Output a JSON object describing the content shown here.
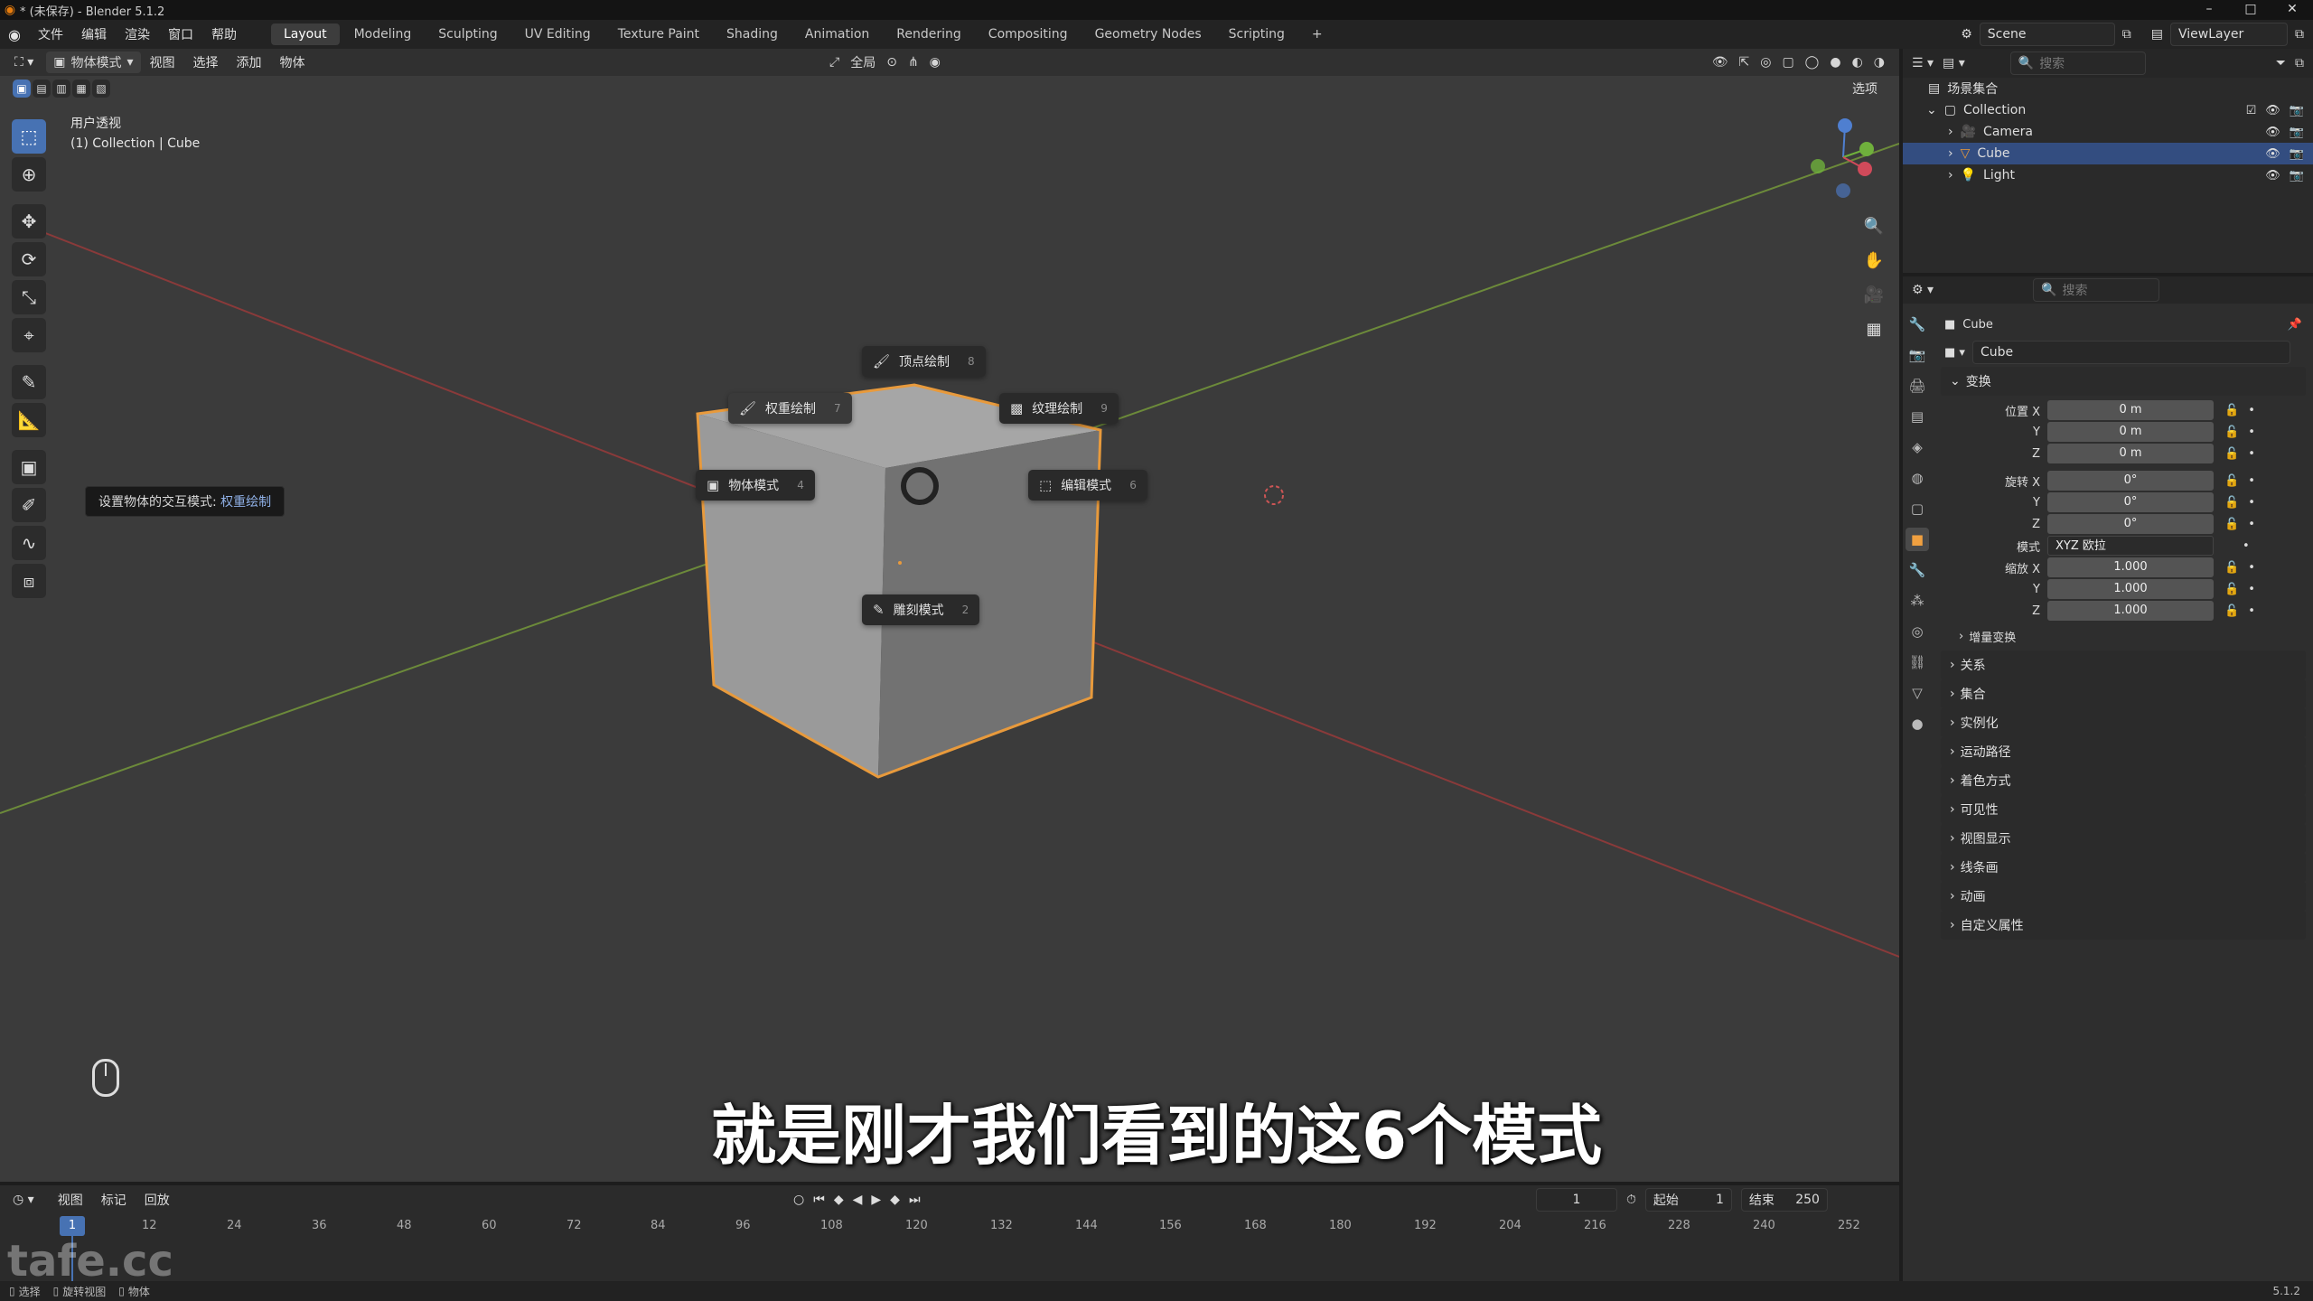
{
  "window": {
    "title": "* (未保存) - Blender 5.1.2",
    "controls": [
      "–",
      "□",
      "✕"
    ]
  },
  "menu": {
    "items": [
      "文件",
      "编辑",
      "渲染",
      "窗口",
      "帮助"
    ],
    "workspaces": [
      "Layout",
      "Modeling",
      "Sculpting",
      "UV Editing",
      "Texture Paint",
      "Shading",
      "Animation",
      "Rendering",
      "Compositing",
      "Geometry Nodes",
      "Scripting"
    ],
    "add_tab": "+",
    "scene": "Scene",
    "view_layer": "ViewLayer"
  },
  "viewport": {
    "mode": "物体模式",
    "menus": [
      "视图",
      "选择",
      "添加",
      "物体"
    ],
    "transform_orientation": "全局",
    "options": "选项",
    "view_name": "用户透视",
    "collection_path": "(1) Collection | Cube",
    "tooltip_prefix": "设置物体的交互模式: ",
    "tooltip_value": "权重绘制"
  },
  "pie_menu": {
    "top": {
      "label": "顶点绘制",
      "key": "8"
    },
    "top_left": {
      "label": "权重绘制",
      "key": "7"
    },
    "top_right": {
      "label": "纹理绘制",
      "key": "9"
    },
    "left": {
      "label": "物体模式",
      "key": "4"
    },
    "right": {
      "label": "编辑模式",
      "key": "6"
    },
    "bottom": {
      "label": "雕刻模式",
      "key": "2"
    }
  },
  "subtitle": "就是刚才我们看到的这6个模式",
  "outliner": {
    "search_placeholder": "搜索",
    "root": "场景集合",
    "collection": "Collection",
    "items": [
      "Camera",
      "Cube",
      "Light"
    ]
  },
  "properties": {
    "search_placeholder": "搜索",
    "object_name": "Cube",
    "object_field": "Cube",
    "transform_header": "变换",
    "location_label": "位置 X",
    "rotation_label": "旋转 X",
    "scale_label": "缩放 X",
    "y_label": "Y",
    "z_label": "Z",
    "location": [
      "0 m",
      "0 m",
      "0 m"
    ],
    "rotation": [
      "0°",
      "0°",
      "0°"
    ],
    "mode_label": "模式",
    "rotation_mode": "XYZ 欧拉",
    "scale": [
      "1.000",
      "1.000",
      "1.000"
    ],
    "delta_transform": "增量变换",
    "panels": [
      "关系",
      "集合",
      "实例化",
      "运动路径",
      "着色方式",
      "可见性",
      "视图显示",
      "线条画",
      "动画",
      "自定义属性"
    ]
  },
  "timeline": {
    "menus": [
      "视图",
      "标记",
      "回放"
    ],
    "current_frame": "1",
    "start_label": "起始",
    "start": "1",
    "end_label": "结束",
    "end": "250",
    "ruler": [
      "1",
      "12",
      "24",
      "36",
      "48",
      "60",
      "72",
      "84",
      "96",
      "108",
      "120",
      "132",
      "144",
      "156",
      "168",
      "180",
      "192",
      "204",
      "216",
      "228",
      "240",
      "252"
    ]
  },
  "status": {
    "items": [
      "选择",
      "旋转视图",
      "物体"
    ],
    "version": "5.1.2"
  },
  "watermark": "tafe.cc",
  "colors": {
    "accent": "#4772b3",
    "selection": "#e89a3c",
    "blender_orange": "#e87d0d"
  }
}
